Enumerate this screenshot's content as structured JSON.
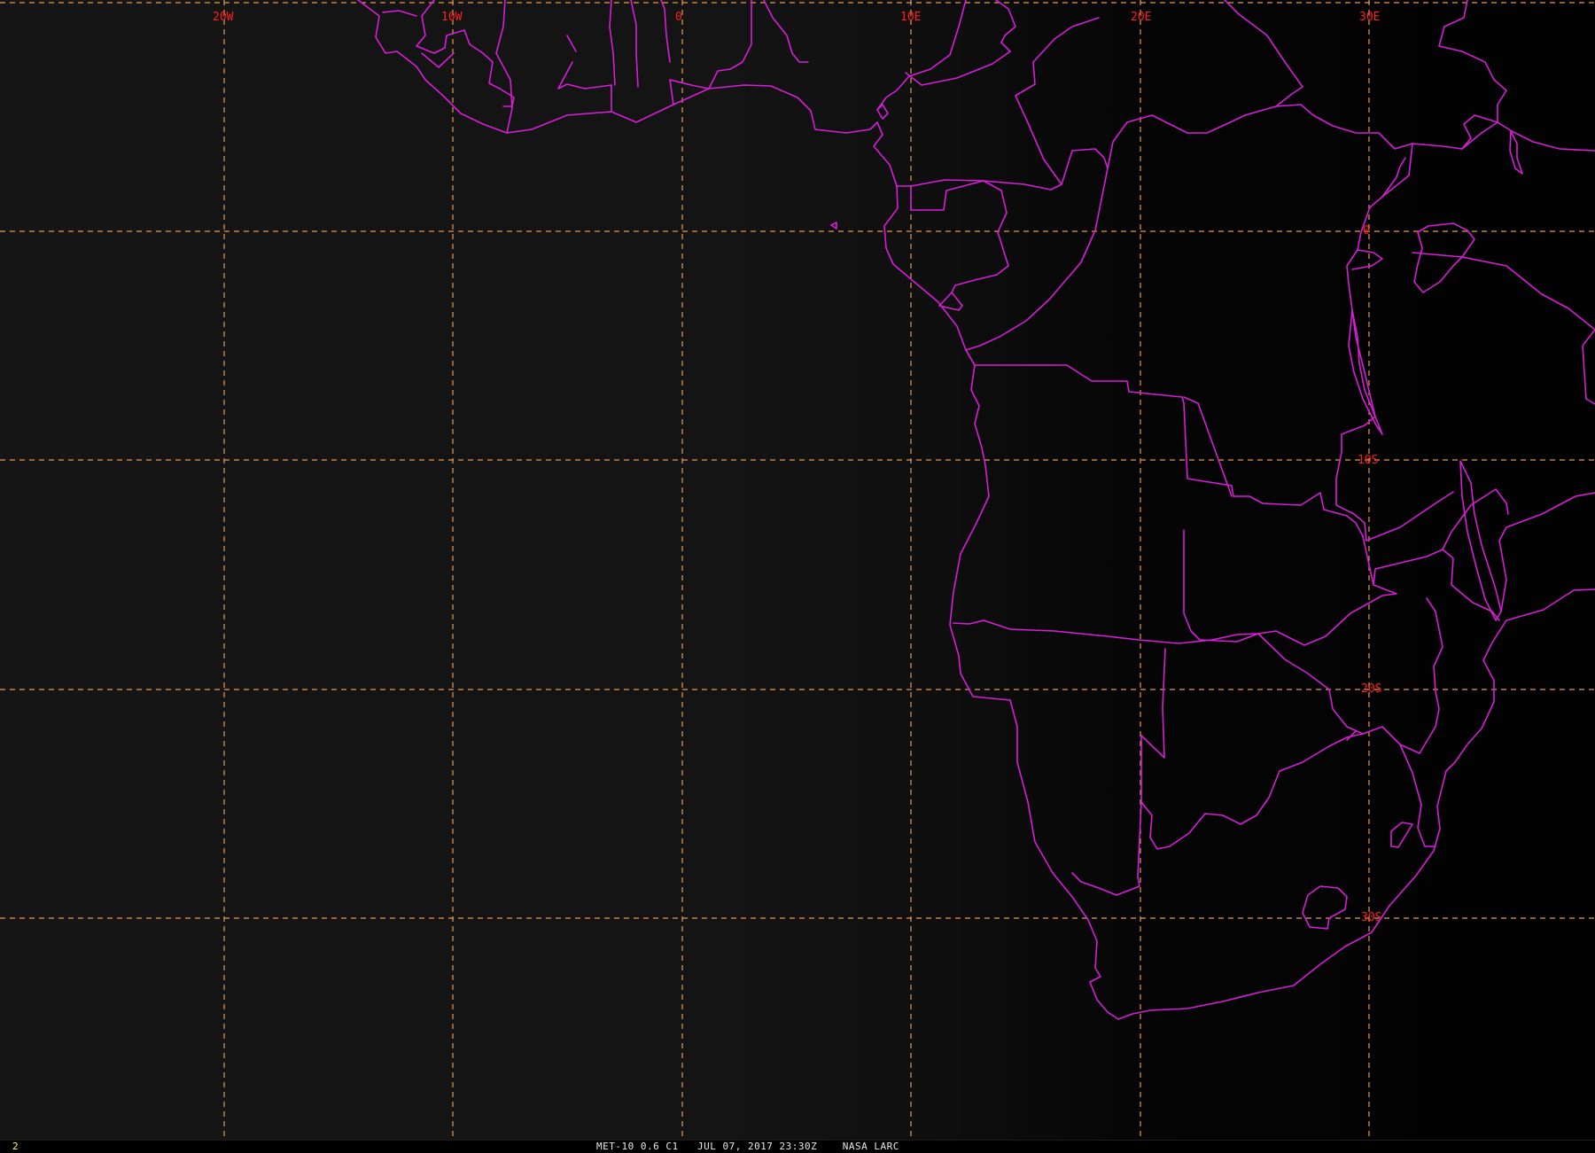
{
  "map": {
    "lon_labels": [
      "20W",
      "10W",
      "0",
      "10E",
      "20E",
      "30E"
    ],
    "lat_labels": [
      "0",
      "10S",
      "20S",
      "30S"
    ],
    "colors": {
      "background_west": "#151515",
      "background_east": "#010101",
      "coastline": "#d61ed6",
      "graticule": "#e39b55",
      "grid_label": "#ff1f1f"
    }
  },
  "status_bar": {
    "frame_number": "2",
    "caption": "MET-10 0.6 C1   JUL 07, 2017 23:30Z    NASA LARC"
  }
}
